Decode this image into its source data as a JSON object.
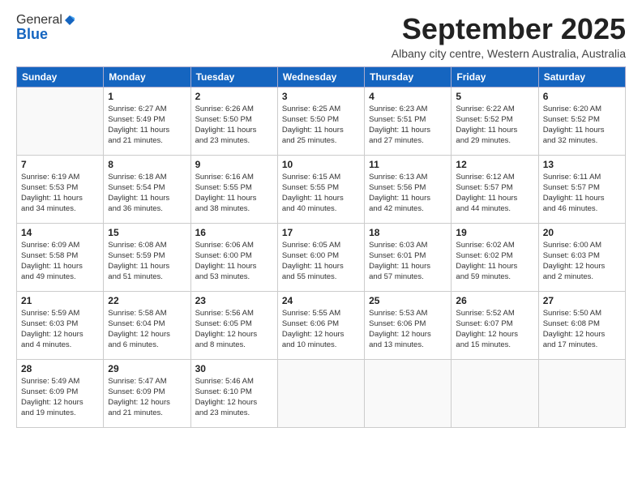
{
  "header": {
    "logo_general": "General",
    "logo_blue": "Blue",
    "month_title": "September 2025",
    "subtitle": "Albany city centre, Western Australia, Australia"
  },
  "calendar": {
    "days_of_week": [
      "Sunday",
      "Monday",
      "Tuesday",
      "Wednesday",
      "Thursday",
      "Friday",
      "Saturday"
    ],
    "weeks": [
      [
        {
          "day": "",
          "info": ""
        },
        {
          "day": "1",
          "info": "Sunrise: 6:27 AM\nSunset: 5:49 PM\nDaylight: 11 hours\nand 21 minutes."
        },
        {
          "day": "2",
          "info": "Sunrise: 6:26 AM\nSunset: 5:50 PM\nDaylight: 11 hours\nand 23 minutes."
        },
        {
          "day": "3",
          "info": "Sunrise: 6:25 AM\nSunset: 5:50 PM\nDaylight: 11 hours\nand 25 minutes."
        },
        {
          "day": "4",
          "info": "Sunrise: 6:23 AM\nSunset: 5:51 PM\nDaylight: 11 hours\nand 27 minutes."
        },
        {
          "day": "5",
          "info": "Sunrise: 6:22 AM\nSunset: 5:52 PM\nDaylight: 11 hours\nand 29 minutes."
        },
        {
          "day": "6",
          "info": "Sunrise: 6:20 AM\nSunset: 5:52 PM\nDaylight: 11 hours\nand 32 minutes."
        }
      ],
      [
        {
          "day": "7",
          "info": "Sunrise: 6:19 AM\nSunset: 5:53 PM\nDaylight: 11 hours\nand 34 minutes."
        },
        {
          "day": "8",
          "info": "Sunrise: 6:18 AM\nSunset: 5:54 PM\nDaylight: 11 hours\nand 36 minutes."
        },
        {
          "day": "9",
          "info": "Sunrise: 6:16 AM\nSunset: 5:55 PM\nDaylight: 11 hours\nand 38 minutes."
        },
        {
          "day": "10",
          "info": "Sunrise: 6:15 AM\nSunset: 5:55 PM\nDaylight: 11 hours\nand 40 minutes."
        },
        {
          "day": "11",
          "info": "Sunrise: 6:13 AM\nSunset: 5:56 PM\nDaylight: 11 hours\nand 42 minutes."
        },
        {
          "day": "12",
          "info": "Sunrise: 6:12 AM\nSunset: 5:57 PM\nDaylight: 11 hours\nand 44 minutes."
        },
        {
          "day": "13",
          "info": "Sunrise: 6:11 AM\nSunset: 5:57 PM\nDaylight: 11 hours\nand 46 minutes."
        }
      ],
      [
        {
          "day": "14",
          "info": "Sunrise: 6:09 AM\nSunset: 5:58 PM\nDaylight: 11 hours\nand 49 minutes."
        },
        {
          "day": "15",
          "info": "Sunrise: 6:08 AM\nSunset: 5:59 PM\nDaylight: 11 hours\nand 51 minutes."
        },
        {
          "day": "16",
          "info": "Sunrise: 6:06 AM\nSunset: 6:00 PM\nDaylight: 11 hours\nand 53 minutes."
        },
        {
          "day": "17",
          "info": "Sunrise: 6:05 AM\nSunset: 6:00 PM\nDaylight: 11 hours\nand 55 minutes."
        },
        {
          "day": "18",
          "info": "Sunrise: 6:03 AM\nSunset: 6:01 PM\nDaylight: 11 hours\nand 57 minutes."
        },
        {
          "day": "19",
          "info": "Sunrise: 6:02 AM\nSunset: 6:02 PM\nDaylight: 11 hours\nand 59 minutes."
        },
        {
          "day": "20",
          "info": "Sunrise: 6:00 AM\nSunset: 6:03 PM\nDaylight: 12 hours\nand 2 minutes."
        }
      ],
      [
        {
          "day": "21",
          "info": "Sunrise: 5:59 AM\nSunset: 6:03 PM\nDaylight: 12 hours\nand 4 minutes."
        },
        {
          "day": "22",
          "info": "Sunrise: 5:58 AM\nSunset: 6:04 PM\nDaylight: 12 hours\nand 6 minutes."
        },
        {
          "day": "23",
          "info": "Sunrise: 5:56 AM\nSunset: 6:05 PM\nDaylight: 12 hours\nand 8 minutes."
        },
        {
          "day": "24",
          "info": "Sunrise: 5:55 AM\nSunset: 6:06 PM\nDaylight: 12 hours\nand 10 minutes."
        },
        {
          "day": "25",
          "info": "Sunrise: 5:53 AM\nSunset: 6:06 PM\nDaylight: 12 hours\nand 13 minutes."
        },
        {
          "day": "26",
          "info": "Sunrise: 5:52 AM\nSunset: 6:07 PM\nDaylight: 12 hours\nand 15 minutes."
        },
        {
          "day": "27",
          "info": "Sunrise: 5:50 AM\nSunset: 6:08 PM\nDaylight: 12 hours\nand 17 minutes."
        }
      ],
      [
        {
          "day": "28",
          "info": "Sunrise: 5:49 AM\nSunset: 6:09 PM\nDaylight: 12 hours\nand 19 minutes."
        },
        {
          "day": "29",
          "info": "Sunrise: 5:47 AM\nSunset: 6:09 PM\nDaylight: 12 hours\nand 21 minutes."
        },
        {
          "day": "30",
          "info": "Sunrise: 5:46 AM\nSunset: 6:10 PM\nDaylight: 12 hours\nand 23 minutes."
        },
        {
          "day": "",
          "info": ""
        },
        {
          "day": "",
          "info": ""
        },
        {
          "day": "",
          "info": ""
        },
        {
          "day": "",
          "info": ""
        }
      ]
    ]
  }
}
